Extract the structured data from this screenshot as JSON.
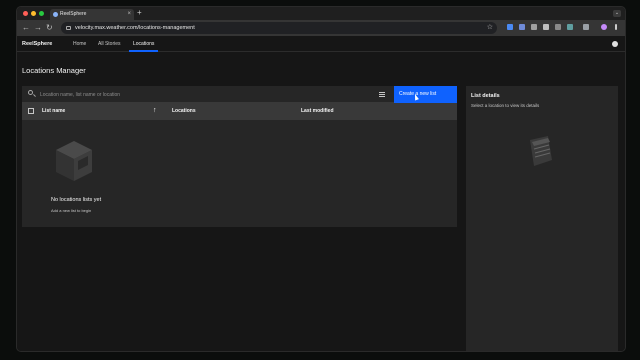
{
  "browser": {
    "tab_title": "ReelSphere",
    "tab_close": "×",
    "new_tab": "+",
    "tab_menu": "⌄",
    "url": "velocity.max.weather.com/locations-management",
    "back": "←",
    "forward": "→",
    "reload": "↻",
    "bookmark": "☆",
    "colors": {
      "close": "#ff5f57",
      "minimize": "#febc2e",
      "maximize": "#28c840"
    }
  },
  "app": {
    "brand": "ReelSphere",
    "nav": [
      {
        "label": "Home"
      },
      {
        "label": "All Stories"
      },
      {
        "label": "Locations",
        "active": true
      }
    ],
    "accent": "#0f62fe"
  },
  "page": {
    "title": "Locations Manager",
    "search_placeholder": "Location name, list name or location",
    "create_button": "Create a new list",
    "columns": [
      "List name",
      "Locations",
      "Last modified"
    ],
    "sort_icon": "arrow-up-icon",
    "empty_title": "No locations lists yet",
    "empty_subtitle": "Add a new list to begin"
  },
  "details": {
    "title": "List details",
    "subtitle": "Select a location to view its details"
  }
}
